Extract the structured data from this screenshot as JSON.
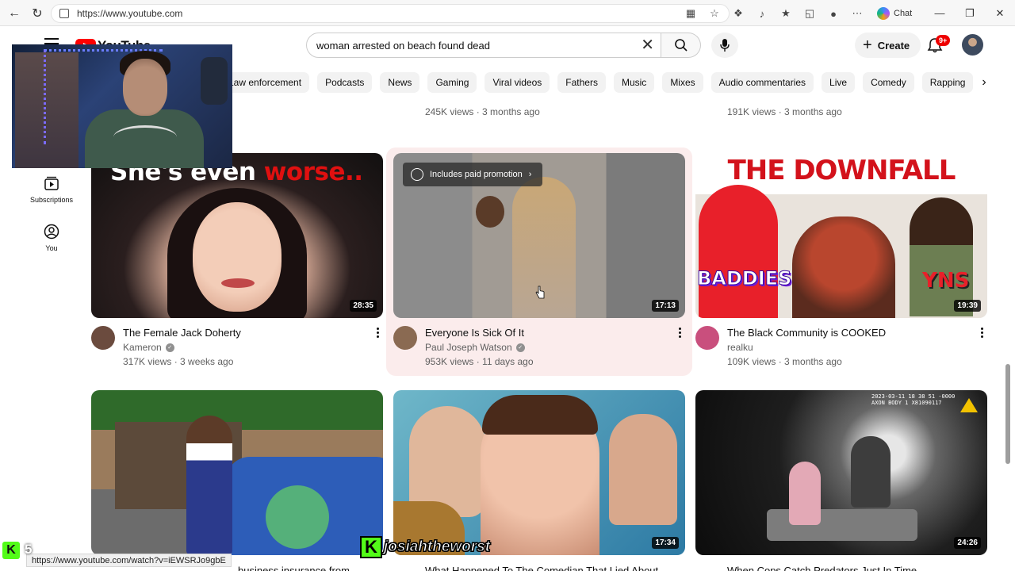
{
  "browser": {
    "url": "https://www.youtube.com",
    "chat_label": "Chat"
  },
  "masthead": {
    "logo_text": "YouTube",
    "search_value": "woman arrested on beach found dead",
    "create_label": "Create",
    "notification_badge": "9+"
  },
  "chips": [
    "Law enforcement",
    "Podcasts",
    "News",
    "Gaming",
    "Viral videos",
    "Fathers",
    "Music",
    "Mixes",
    "Audio commentaries",
    "Live",
    "Comedy",
    "Rapping"
  ],
  "rail": {
    "subscriptions": "Subscriptions",
    "you": "You"
  },
  "previous_row": {
    "col2_meta": "245K views · 3 months ago",
    "col3_meta": "191K views · 3 months ago"
  },
  "videos": [
    {
      "title": "The Female Jack Doherty",
      "channel": "Kameron",
      "meta": "317K views · 3 weeks ago",
      "duration": "28:35",
      "thumb_text": "She's even",
      "thumb_text_red": "worse..",
      "avatar_color": "#6b4b3e"
    },
    {
      "title": "Everyone Is Sick Of It",
      "channel": "Paul Joseph Watson",
      "meta": "953K views · 11 days ago",
      "duration": "17:13",
      "promo": "Includes paid promotion",
      "avatar_color": "#8a6a52"
    },
    {
      "title": "The Black Community is COOKED",
      "channel": "realku",
      "meta": "109K views · 3 months ago",
      "duration": "19:39",
      "thumb_headline": "THE DOWNFALL",
      "thumb_left": "BADDIES",
      "thumb_right": "YNS",
      "avatar_color": "#c94f7d"
    },
    {
      "duration": "",
      "partial_title": "business insurance from"
    },
    {
      "duration": "17:34",
      "partial_title": "What Happened To The Comedian That Lied About"
    },
    {
      "duration": "24:26",
      "partial_title": "When Cops Catch Predators Just In Time",
      "cam_text_1": "2023-03-11 18 38 51 -0000",
      "cam_text_2": "AXON BODY 1 X81090117"
    }
  ],
  "overlays": {
    "status_url": "https://www.youtube.com/watch?v=iEWSRJo9gbE",
    "kick_count": "5",
    "watermark_k": "K",
    "watermark_name": "josiahtheworst"
  },
  "colors": {
    "youtube_red": "#ff0000",
    "kick_green": "#53fc18",
    "hover_bg": "#fbecec"
  }
}
